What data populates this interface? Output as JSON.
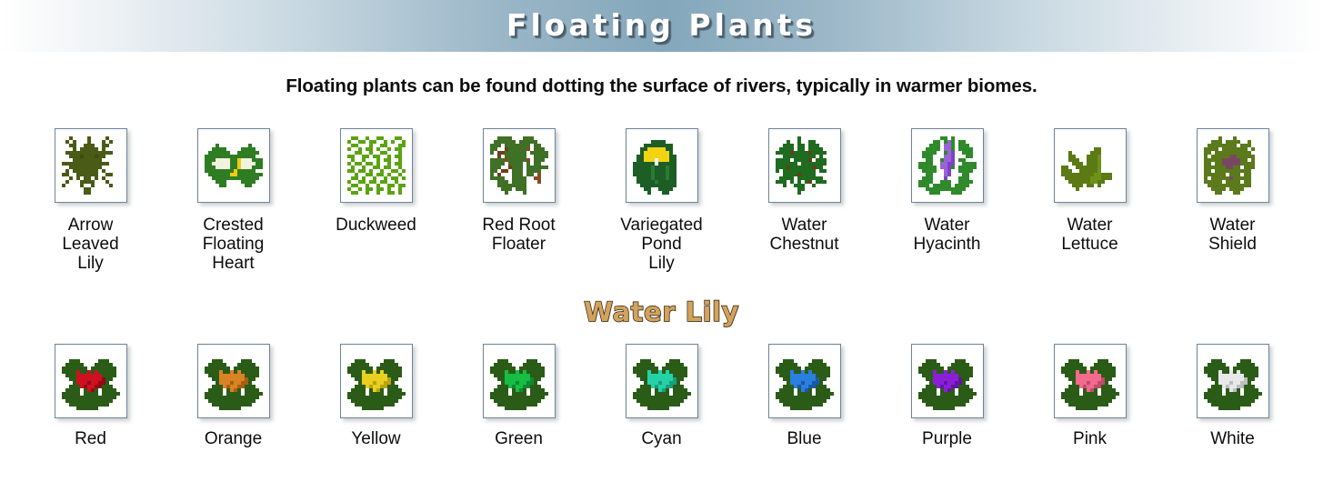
{
  "header": {
    "title": "Floating Plants",
    "gradient_center": "#84a7bb",
    "title_color": "#ffffff"
  },
  "intro": {
    "text": "Floating plants can be found dotting the surface of rivers, typically in warmer biomes."
  },
  "sections": {
    "lily_heading": "Water Lily",
    "lily_heading_color": "#d3a25c",
    "lily_heading_outline": "#2b2112"
  },
  "frame": {
    "border_color": "#6d8498",
    "background": "#ffffff"
  },
  "plants": [
    {
      "label": "Arrow\nLeaved\nLily",
      "icon_name": "arrow-leaved-lily-icon",
      "palette": [
        "#4a5a17",
        "#3d4d10",
        "#61741f"
      ],
      "pattern": [
        "..1....1....1...",
        ".1.1...1...1.1..",
        "..11..111..11...",
        "...1.11111.1....",
        ".1111111111111..",
        "..1112111211....",
        "...11111111.....",
        "1111111111111...",
        "..111111111.....",
        ".1.1111111.1....",
        "11..111111..11..",
        "..1.1.11.1.1....",
        ".1...1111...1...",
        "1....1..1....1..",
        "......11........",
        "......11........"
      ]
    },
    {
      "label": "Crested\nFloating\nHeart",
      "icon_name": "crested-floating-heart-icon",
      "palette": [
        "#2e7d22",
        "#f2f2e0",
        "#f2cc0c",
        "#246b1a"
      ],
      "pattern": [
        "................",
        "................",
        "...1........1...",
        "..1111....1111..",
        ".111111..111111.",
        "11111111111111..",
        "1112222113222111",
        "1122222113222211",
        "1112222113222111",
        "11111111311111..",
        ".111111331111111",
        "..1111111111111.",
        "...111....1111..",
        "....11.....11...",
        "................",
        "................"
      ]
    },
    {
      "label": "Duckweed",
      "icon_name": "duckweed-icon",
      "palette": [
        "#5ba312",
        "#74bb1c",
        "#468a0c"
      ],
      "pattern": [
        ".11..1..11...11.",
        "1..11.11..1.1..1",
        ".11...1..11...11",
        "1..1.11.1..1.11.",
        "..11..1..11...1.",
        "11..11.11..1.11.",
        ".1..1...1.11..1.",
        "1.11.11.1..1.11.",
        ".1..1..11.11..1.",
        "11.11.1..1..11.1",
        "..1..11.11.1..1.",
        ".11.1..1..1.11.1",
        "1..11.11.11..1..",
        ".11..1..1..11.11",
        "1..1.11.11.1..1.",
        ".11..1..1..11.1."
      ]
    },
    {
      "label": "Red Root\nFloater",
      "icon_name": "red-root-floater-icon",
      "palette": [
        "#3f7026",
        "#6b3f1c",
        "#8a4a22",
        "#2f5a1c"
      ],
      "pattern": [
        "..1111...111....",
        ".111111.11111...",
        "111.1111111.11..",
        "11..2111113.111.",
        "1.22111111.11111",
        "..2.111111..1111",
        "11113111113.111.",
        "1111.1111.1.11..",
        "111..2111.111111",
        "11.22.111.1111..",
        "1.2...111.11.3..",
        "1111..1111..33..",
        "..111.1111...3..",
        "..11111111......",
        "...111.111......",
        "....1....1......"
      ]
    },
    {
      "label": "Variegated\nPond\nLily",
      "icon_name": "variegated-pond-lily-icon",
      "palette": [
        "#1c5e26",
        "#f2d413",
        "#2d7a33",
        "#144a1c"
      ],
      "pattern": [
        "................",
        ".....1111.......",
        "...11111111.....",
        "..112222211.....",
        "..122222221.....",
        ".11222222211....",
        ".11222.22211....",
        "111111.11111....",
        "111113111311....",
        "111113111311....",
        "111113111311....",
        ".11113111311....",
        ".11111311111....",
        "..1111111111....",
        "...11..1111.....",
        "....1...11......"
      ]
    },
    {
      "label": "Water\nChestnut",
      "icon_name": "water-chestnut-icon",
      "palette": [
        "#1f6b20",
        "#6b3b1c",
        "#2a8229"
      ],
      "pattern": [
        "......1.........",
        "...1..1..11.....",
        "..111.11.111....",
        ".1111.11.1111...",
        "11112111121111..",
        "..111111111.1...",
        "1111.11112.111..",
        "111111.1111111..",
        "1112111111211...",
        "1.111111111.11..",
        "..111121111.....",
        ".1111.1111111...",
        "111.1.1.12.111..",
        "..1..111..1.....",
        "......11........",
        "......1........."
      ]
    },
    {
      "label": "Water\nHyacinth",
      "icon_name": "water-hyacinth-icon",
      "palette": [
        "#2f8a2b",
        "#9b63d6",
        "#7a44c4",
        "#1f6d1f"
      ],
      "pattern": [
        "......11.1......",
        "....11.121.11...",
        "...111.221.111..",
        "..1111.221.1111.",
        ".1111..123..111.",
        ".111...223...11.",
        "..11..1223.11...",
        "1111..2233..1111",
        "11111.2231.11111",
        ".1111..23..1111.",
        "..11...23...11..",
        ".111...3...111..",
        "1111..111..1111.",
        "111.11111.1111..",
        "..11111111111...",
        "...111...111...."
      ]
    },
    {
      "label": "Water\nLettuce",
      "icon_name": "water-lettuce-icon",
      "palette": [
        "#5b7a14",
        "#6f9119",
        "#47630e"
      ],
      "pattern": [
        "................",
        "................",
        "................",
        ".........11.....",
        "..1.....111.....",
        "..11...1112.....",
        "..111..1112.....",
        "...111.1112.....",
        "11..1111112.....",
        "111..111112.....",
        "11111111122111..",
        ".1111111222111..",
        "..1111112211....",
        "...111.11.1.....",
        "....1...........",
        "................"
      ]
    },
    {
      "label": "Water\nShield",
      "icon_name": "water-shield-icon",
      "palette": [
        "#5b7a1c",
        "#7a4763",
        "#6b9122"
      ],
      "pattern": [
        "....1...1.......",
        "..111.1111..1...",
        ".11111111.111...",
        "1111.1111111.1..",
        "11.1111111111...",
        "1.111112211111..",
        "111112222211.1..",
        "11.11222221111..",
        "1111112211.111..",
        "11.1111111111...",
        "111111.111.11...",
        "1.11111211111...",
        "11111.1111.11...",
        ".111111111111...",
        "..1111.1111.....",
        "...11...11......"
      ]
    }
  ],
  "lilies": [
    {
      "label": "Red",
      "icon_name": "water-lily-red-icon",
      "flower_color": "#cf1020",
      "flower_shade": "#8f0a16"
    },
    {
      "label": "Orange",
      "icon_name": "water-lily-orange-icon",
      "flower_color": "#d98324",
      "flower_shade": "#a75f13"
    },
    {
      "label": "Yellow",
      "icon_name": "water-lily-yellow-icon",
      "flower_color": "#e8cf20",
      "flower_shade": "#b9a313"
    },
    {
      "label": "Green",
      "icon_name": "water-lily-green-icon",
      "flower_color": "#17bd44",
      "flower_shade": "#0d8a30"
    },
    {
      "label": "Cyan",
      "icon_name": "water-lily-cyan-icon",
      "flower_color": "#25d2a8",
      "flower_shade": "#17a07e"
    },
    {
      "label": "Blue",
      "icon_name": "water-lily-blue-icon",
      "flower_color": "#2a7fe0",
      "flower_shade": "#1a59a8"
    },
    {
      "label": "Purple",
      "icon_name": "water-lily-purple-icon",
      "flower_color": "#8b1fd6",
      "flower_shade": "#6614a3"
    },
    {
      "label": "Pink",
      "icon_name": "water-lily-pink-icon",
      "flower_color": "#f26a8d",
      "flower_shade": "#c44a6c"
    },
    {
      "label": "White",
      "icon_name": "water-lily-white-icon",
      "flower_color": "#e8e8e8",
      "flower_shade": "#bdbdbd"
    }
  ],
  "lily_icon_base": {
    "pad_color": "#2a5c17",
    "pad_dark": "#1e4410",
    "pattern": [
      "................",
      "................",
      "..111.....111...",
      ".11111...11111..",
      "1111111.1111111.",
      "1111F11F1F11111.",
      ".111FFFFFFF1111.",
      "..11FFFFFFFG11..",
      "...1FFFGFFGG1...",
      "..111FGFFGG111..",
      ".1111.1FG1.1111.",
      "11111.1111.11111",
      "111111111111111.",
      ".1111111111111..",
      "..11111111111...",
      "....111111......"
    ]
  }
}
